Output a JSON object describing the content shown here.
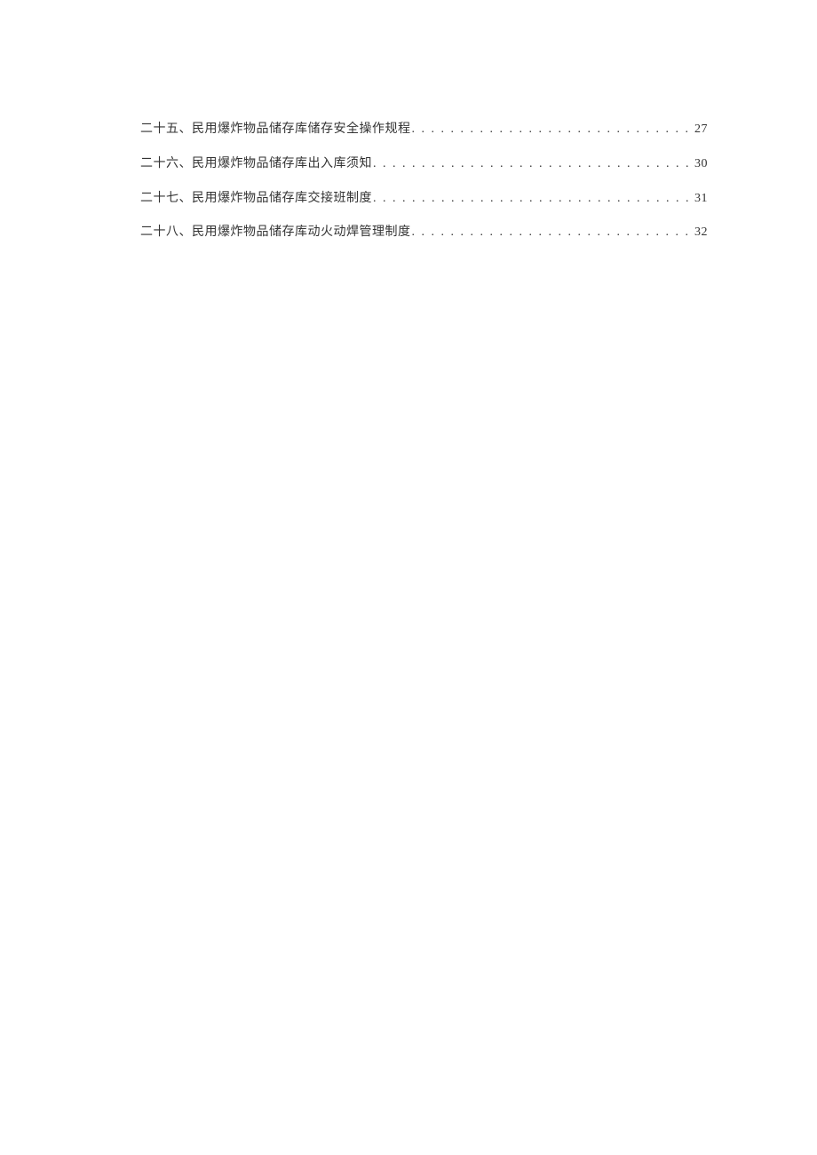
{
  "toc": [
    {
      "title": "二十五、民用爆炸物品储存库储存安全操作规程",
      "page": "27"
    },
    {
      "title": "二十六、民用爆炸物品储存库出入库须知",
      "page": "30"
    },
    {
      "title": "二十七、民用爆炸物品储存库交接班制度",
      "page": "31"
    },
    {
      "title": "二十八、民用爆炸物品储存库动火动焊管理制度",
      "page": "32"
    }
  ]
}
